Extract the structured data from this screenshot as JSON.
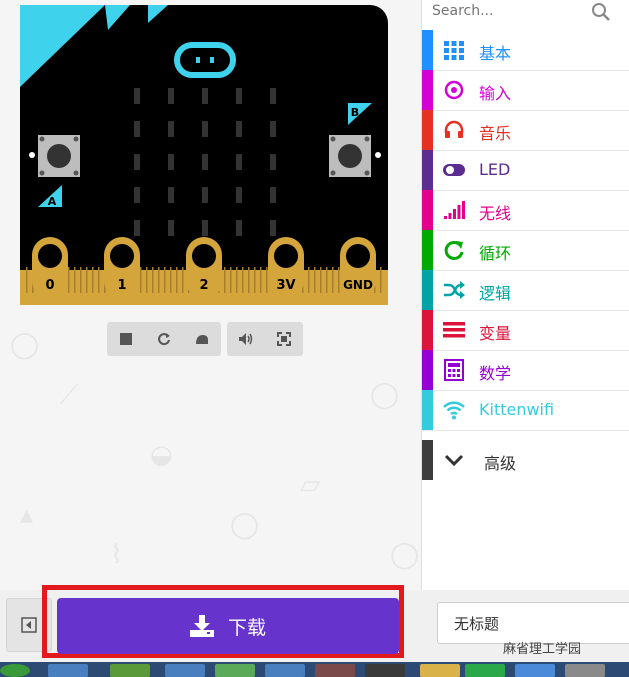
{
  "board": {
    "button_a_label": "A",
    "button_b_label": "B",
    "pins": [
      "0",
      "1",
      "2",
      "3V",
      "GND"
    ],
    "colors": {
      "body": "#000000",
      "accent": "#3fd2ec",
      "gold": "#d4a53a",
      "bevel": "#a77f2a"
    }
  },
  "sim_controls": [
    "stop-icon",
    "restart-icon",
    "slow-motion-icon",
    "mute-icon",
    "fullscreen-icon"
  ],
  "search": {
    "placeholder": "Search..."
  },
  "toolbox": {
    "categories": [
      {
        "label": "基本",
        "icon": "grid-icon",
        "color": "#1e90ff"
      },
      {
        "label": "输入",
        "icon": "target-icon",
        "color": "#d400d4"
      },
      {
        "label": "音乐",
        "icon": "headphones-icon",
        "color": "#e63022"
      },
      {
        "label": "LED",
        "icon": "toggle-icon",
        "color": "#5c2d91"
      },
      {
        "label": "无线",
        "icon": "signal-bars-icon",
        "color": "#e3008c"
      },
      {
        "label": "循环",
        "icon": "loop-icon",
        "color": "#00aa00"
      },
      {
        "label": "逻辑",
        "icon": "shuffle-icon",
        "color": "#00a4a6"
      },
      {
        "label": "变量",
        "icon": "list-icon",
        "color": "#dc143c"
      },
      {
        "label": "数学",
        "icon": "calculator-icon",
        "color": "#9400d3"
      },
      {
        "label": "Kittenwifi",
        "icon": "wifi-icon",
        "color": "#33ccdd"
      }
    ],
    "advanced_label": "高级"
  },
  "bottom": {
    "download_label": "下载",
    "project_name": "无标题",
    "watermark": "麻省理工学园"
  },
  "colors": {
    "download_button": "#6633cc",
    "highlight_frame": "#e2191d"
  }
}
